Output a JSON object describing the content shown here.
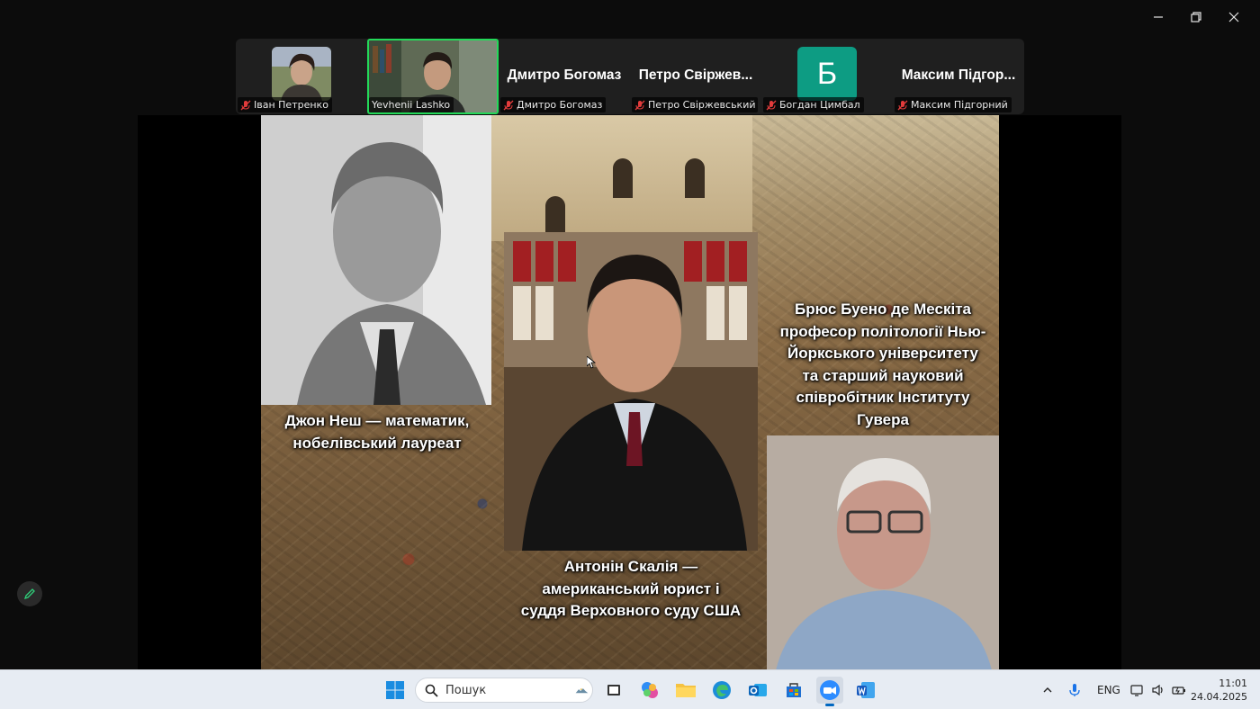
{
  "window": {
    "minimize_icon": "minimize-icon",
    "restore_icon": "restore-icon",
    "close_icon": "close-icon"
  },
  "participants": [
    {
      "name": "Іван Петренко",
      "mic": "muted",
      "video": true
    },
    {
      "name": "Yevhenii Lashko",
      "mic": "on",
      "video": true,
      "speaking": true
    },
    {
      "name": "Дмитро Богомаз",
      "display_name": "Дмитро Богомаз",
      "mic": "muted",
      "video": false
    },
    {
      "name": "Петро Свіржевський",
      "display_name": "Петро Свіржев...",
      "mic": "muted",
      "video": false
    },
    {
      "name": "Богдан Цимбал",
      "initial": "Б",
      "mic": "muted",
      "video": false,
      "avatar_color": "#0d9c83"
    },
    {
      "name": "Максим Підгорний",
      "display_name": "Максим Підгор...",
      "mic": "muted",
      "video": false
    }
  ],
  "slide": {
    "captions": {
      "nash": [
        "Джон Неш — математик,",
        "нобелівський лауреат"
      ],
      "scalia": [
        "Антонін Скалія —",
        "американський юрист і",
        "суддя Верховного суду США"
      ],
      "bdm": [
        "Брюс Буено де Мескіта",
        "професор політології Нью-",
        "Йоркського університету",
        "та старший науковий",
        "співробітник Інституту",
        "Гувера"
      ]
    }
  },
  "taskbar": {
    "search_placeholder": "Пошук",
    "language": "ENG",
    "time": "11:01",
    "date": "24.04.2025",
    "accent": "#0067c0"
  }
}
